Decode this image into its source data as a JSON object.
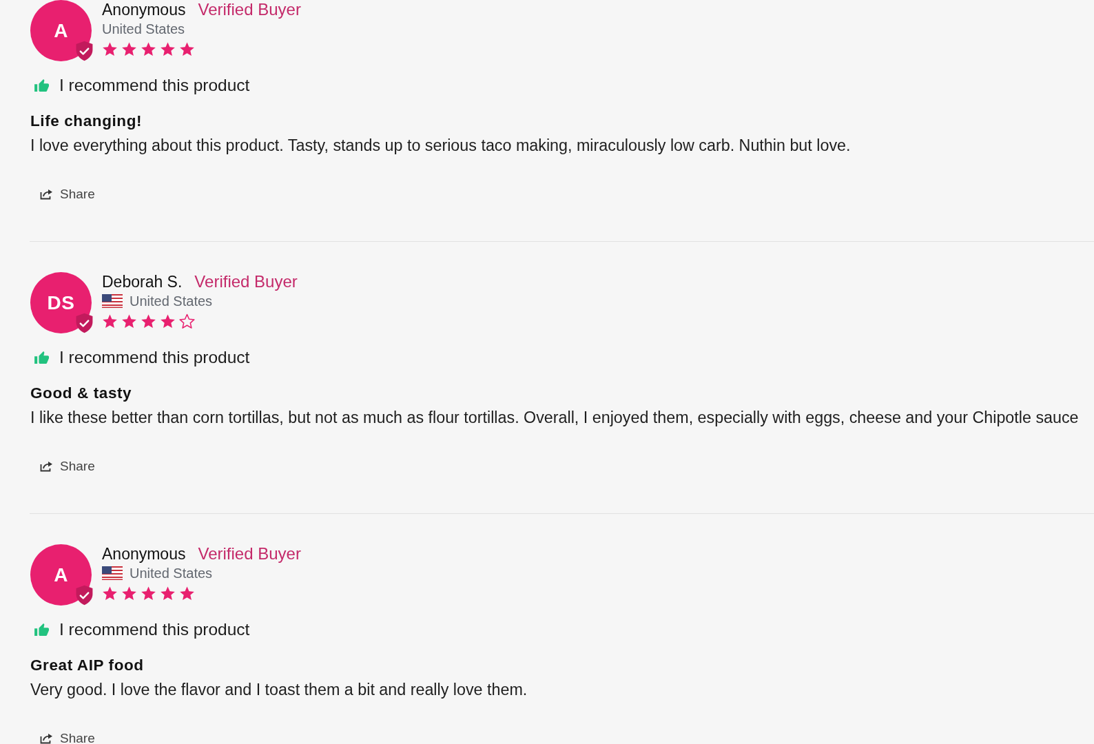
{
  "reviews": [
    {
      "initials": "A",
      "name": "Anonymous",
      "badge": "Verified Buyer",
      "country": "United States",
      "flag": false,
      "stars": 5,
      "recommend": "I recommend this product",
      "title": "Life changing!",
      "body": "I love everything about this product. Tasty, stands up to serious taco making, miraculously low carb. Nuthin but love.",
      "share": "Share"
    },
    {
      "initials": "DS",
      "name": "Deborah S.",
      "badge": "Verified Buyer",
      "country": "United States",
      "flag": true,
      "stars": 4,
      "recommend": "I recommend this product",
      "title": "Good & tasty",
      "body": "I like these better than corn tortillas, but not as much as flour tortillas. Overall, I enjoyed them, especially with eggs, cheese and your Chipotle sauce",
      "share": "Share"
    },
    {
      "initials": "A",
      "name": "Anonymous",
      "badge": "Verified Buyer",
      "country": "United States",
      "flag": true,
      "stars": 5,
      "recommend": "I recommend this product",
      "title": "Great AIP food",
      "body": "Very good. I love the flavor and I toast them a bit and really love them.",
      "share": "Share"
    }
  ]
}
